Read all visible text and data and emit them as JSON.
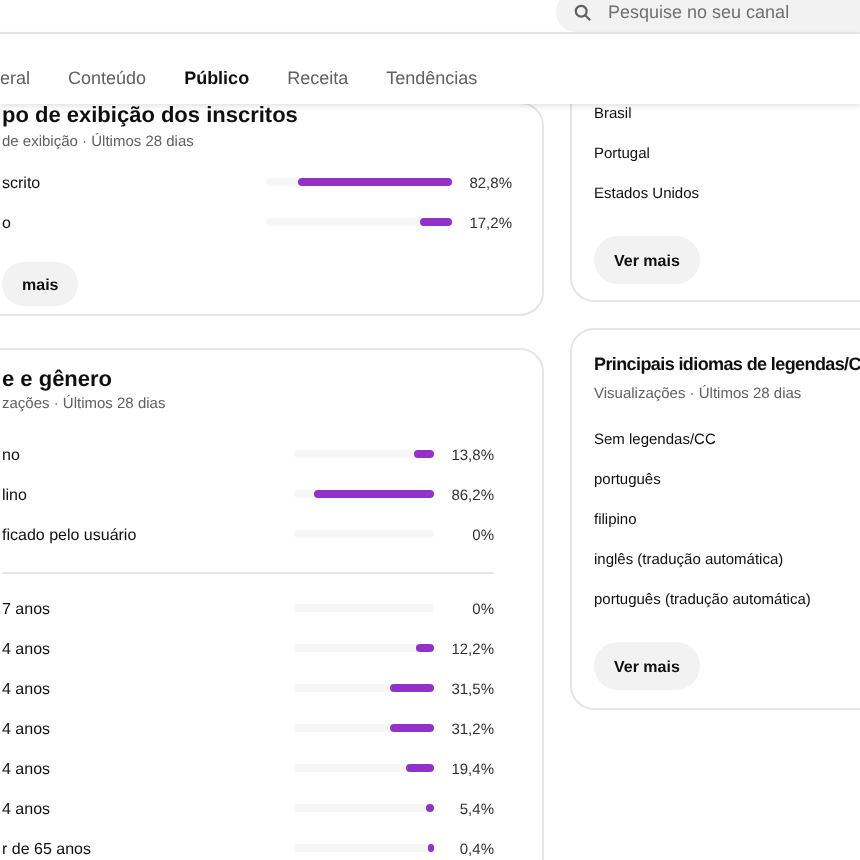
{
  "search": {
    "placeholder": "Pesquise no seu canal"
  },
  "tabs": [
    {
      "label": "eral",
      "selected": false
    },
    {
      "label": "Conteúdo",
      "selected": false
    },
    {
      "label": "Público",
      "selected": true
    },
    {
      "label": "Receita",
      "selected": false
    },
    {
      "label": "Tendências",
      "selected": false
    }
  ],
  "left_cards": [
    {
      "title": "po de exibição dos inscritos",
      "subtitle": "de exibição · Últimos 28 dias",
      "groups": [
        [
          {
            "label": "scrito",
            "level": 0.828,
            "reading": "82,8%"
          },
          {
            "label": "o",
            "level": 0.172,
            "reading": "17,2%"
          }
        ]
      ],
      "button": "mais"
    },
    {
      "title": "e e gênero",
      "subtitle": "zações · Últimos 28 dias",
      "groups": [
        [
          {
            "label": "no",
            "level": 0.138,
            "reading": "13,8%"
          },
          {
            "label": "lino",
            "level": 0.862,
            "reading": "86,2%"
          },
          {
            "label": "ficado pelo usuário",
            "reading": "0%"
          }
        ],
        [
          {
            "label": "7 anos",
            "reading": "0%"
          },
          {
            "label": "4 anos",
            "level": 0.122,
            "reading": "12,2%"
          },
          {
            "label": "4 anos",
            "level": 0.315,
            "reading": "31,5%"
          },
          {
            "label": "4 anos",
            "level": 0.312,
            "reading": "31,2%"
          },
          {
            "label": "4 anos",
            "level": 0.194,
            "reading": "19,4%"
          },
          {
            "label": "4 anos",
            "level": 0.054,
            "reading": "5,4%"
          },
          {
            "label": "r de 65 anos",
            "level": 0.004,
            "reading": "0,4%"
          }
        ]
      ]
    }
  ],
  "right_cards": [
    {
      "items": [
        "Brasil",
        "Portugal",
        "Estados Unidos"
      ],
      "button": "Ver mais"
    },
    {
      "title": "Principais idiomas de legendas/C",
      "subtitle": "Visualizações · Últimos 28 dias",
      "items": [
        "Sem legendas/CC",
        "português",
        "filipino",
        "inglês (tradução automática)",
        "português (tradução automática)"
      ],
      "button": "Ver mais"
    }
  ]
}
